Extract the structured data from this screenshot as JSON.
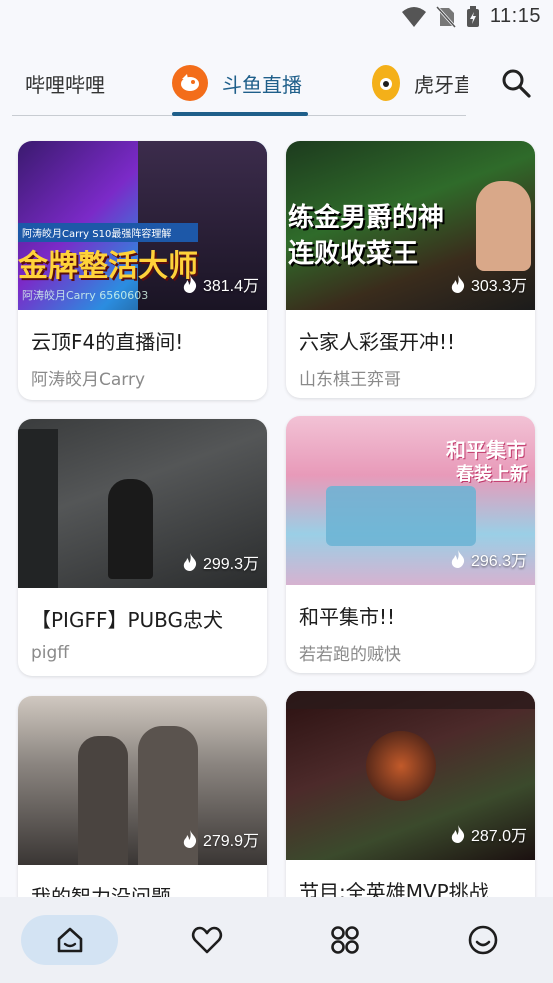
{
  "status_bar": {
    "time": "11:15"
  },
  "tabs": [
    {
      "label": "哔哩哔哩",
      "active": false
    },
    {
      "label": "斗鱼直播",
      "active": true
    },
    {
      "label": "虎牙直",
      "active": false
    }
  ],
  "colors": {
    "accent": "#1f5f8a",
    "douyu": "#f36d1a",
    "huya": "#f4b019",
    "nav_active": "#d3e3f3"
  },
  "cards": [
    {
      "title": "云顶F4的直播间!",
      "streamer": "阿涛皎月Carry",
      "heat": "381.4万",
      "overlay_top": "阿涛皎月Carry    S10最强阵容理解",
      "overlay_main": "金牌整活大师",
      "overlay_bottom": "阿涛皎月Carry 6560603"
    },
    {
      "title": "六家人彩蛋开冲!!",
      "streamer": "山东棋王弈哥",
      "heat": "303.3万",
      "overlay_main": "练金男爵的神",
      "overlay_sub": "连败收菜王"
    },
    {
      "title": "【PIGFF】PUBG忠犬",
      "streamer": "pigff",
      "heat": "299.3万"
    },
    {
      "title": "和平集市!!",
      "streamer": "若若跑的贼快",
      "heat": "296.3万",
      "overlay_main": "和平集市",
      "overlay_sub": "春装上新"
    },
    {
      "title": "我的智力没问题",
      "streamer": "",
      "heat": "279.9万"
    },
    {
      "title": "节目:全英雄MVP挑战",
      "streamer": "",
      "heat": "287.0万"
    }
  ],
  "bottom_nav": [
    {
      "icon": "home-icon",
      "active": true
    },
    {
      "icon": "heart-icon",
      "active": false
    },
    {
      "icon": "category-icon",
      "active": false
    },
    {
      "icon": "smile-icon",
      "active": false
    }
  ]
}
